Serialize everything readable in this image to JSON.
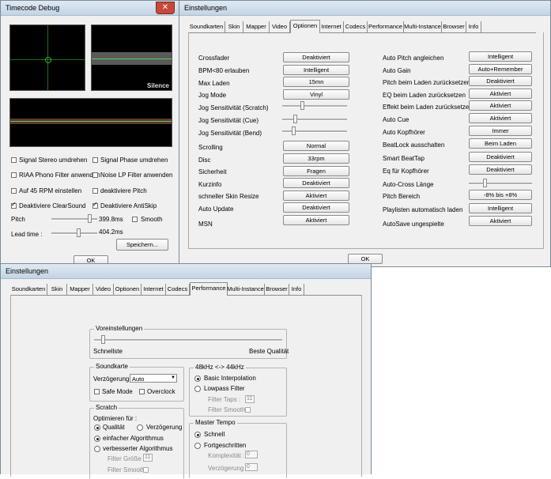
{
  "timecode": {
    "title": "Timecode Debug",
    "silence_label": "Silence",
    "checkboxes": [
      {
        "label": "Signal Stereo umdrehen",
        "checked": false
      },
      {
        "label": "Signal Phase umdrehen",
        "checked": false
      },
      {
        "label": "RIAA Phono Filter anwenden",
        "checked": false
      },
      {
        "label": "Noise LP Filter anwenden",
        "checked": false
      },
      {
        "label": "Auf 45 RPM einstellen",
        "checked": false
      },
      {
        "label": "deaktiviere Pitch",
        "checked": false
      },
      {
        "label": "Deaktiviere ClearSound",
        "checked": true
      },
      {
        "label": "Deaktiviere AntiSkip",
        "checked": true
      }
    ],
    "pitch_label": "Pitch",
    "pitch_value": "399.8ms",
    "smooth_label": "Smooth",
    "leadtime_label": "Lead time :",
    "leadtime_value": "404.2ms",
    "save_label": "Speichern...",
    "ok_label": "OK"
  },
  "settings1": {
    "title": "Einstellungen",
    "tabs": [
      "Soundkarten",
      "Skin",
      "Mapper",
      "Video",
      "Optionen",
      "Internet",
      "Codecs",
      "Performance",
      "Multi-Instance",
      "Browser",
      "Info"
    ],
    "active_tab": "Optionen",
    "left": [
      {
        "label": "Crossfader",
        "value": "Deaktiviert"
      },
      {
        "label": "BPM<80 erlauben",
        "value": "Intelligent"
      },
      {
        "label": "Max Laden",
        "value": "15mn"
      },
      {
        "label": "Jog Mode",
        "value": "Vinyl"
      },
      {
        "label": "Jog Sensitivität (Scratch)"
      },
      {
        "label": "Jog Sensitivität (Cue)"
      },
      {
        "label": "Jog Sensitivität (Bend)"
      },
      {
        "label": "Scrolling",
        "value": "Normal"
      },
      {
        "label": "Disc",
        "value": "33rpm"
      },
      {
        "label": "Sicherheit",
        "value": "Fragen"
      },
      {
        "label": "Kurzinfo",
        "value": "Deaktiviert"
      },
      {
        "label": "schneller Skin Resize",
        "value": "Aktiviert"
      },
      {
        "label": "Auto Update",
        "value": "Deaktiviert"
      },
      {
        "label": "MSN",
        "value": "Aktiviert"
      }
    ],
    "right": [
      {
        "label": "Auto Pitch angleichen",
        "value": "Intelligent"
      },
      {
        "label": "Auto Gain",
        "value": "Auto+Remember"
      },
      {
        "label": "Pitch beim Laden zurücksetzen",
        "value": "Deaktiviert"
      },
      {
        "label": "EQ beim Laden zurücksetzen",
        "value": "Aktiviert"
      },
      {
        "label": "Effekt beim Laden zurücksetzen",
        "value": "Aktiviert"
      },
      {
        "label": "Auto Cue",
        "value": "Aktiviert"
      },
      {
        "label": "Auto Kopfhörer",
        "value": "Immer"
      },
      {
        "label": "BeatLock ausschalten",
        "value": "Beim Laden"
      },
      {
        "label": "Smart BeatTap",
        "value": "Deaktiviert"
      },
      {
        "label": "Eq für Kopfhörer",
        "value": "Deaktiviert"
      },
      {
        "label": "Auto-Cross Länge"
      },
      {
        "label": "Pitch Bereich",
        "value": "-8% bis +8%"
      },
      {
        "label": "Playlisten automatisch laden",
        "value": "Intelligent"
      },
      {
        "label": "AutoSave ungespielte",
        "value": "Aktiviert"
      }
    ],
    "ok_label": "OK"
  },
  "settings2": {
    "title": "Einstellungen",
    "tabs": [
      "Soundkarten",
      "Skin",
      "Mapper",
      "Video",
      "Optionen",
      "Internet",
      "Codecs",
      "Performance",
      "Multi-Instance",
      "Browser",
      "Info"
    ],
    "active_tab": "Performance",
    "presets_title": "Voreinstellungen",
    "fastest": "Schnellste",
    "best_quality": "Beste Qualität",
    "soundcard_title": "Soundkarte",
    "delay_label": "Verzögerung :",
    "delay_value": "Auto",
    "safe_mode": "Safe Mode",
    "overclock": "Overclock",
    "resample_title": "48kHz <-> 44kHz",
    "basic_interp": "Basic Interpolation",
    "lowpass": "Lowpass Filter",
    "filter_taps": "Filter Taps :",
    "filter_taps_value": "11",
    "filter_smooth": "Filter Smooth",
    "scratch_title": "Scratch",
    "optimize_for": "Optimieren für :",
    "quality": "Qualität",
    "latency": "Verzögerung",
    "simple_algo": "einfacher Algorithmus",
    "improved_algo": "verbesserter Algorithmus",
    "filter_size": "Filter Größe :",
    "filter_size_value": "11",
    "scratch_filter_smooth": "Filter Smooth",
    "master_tempo_title": "Master Tempo",
    "fast": "Schnell",
    "advanced": "Fortgeschritten",
    "complexity": "Komplexität :",
    "complexity_value": "0",
    "delay2": "Verzögerung :",
    "delay2_value": "0"
  }
}
